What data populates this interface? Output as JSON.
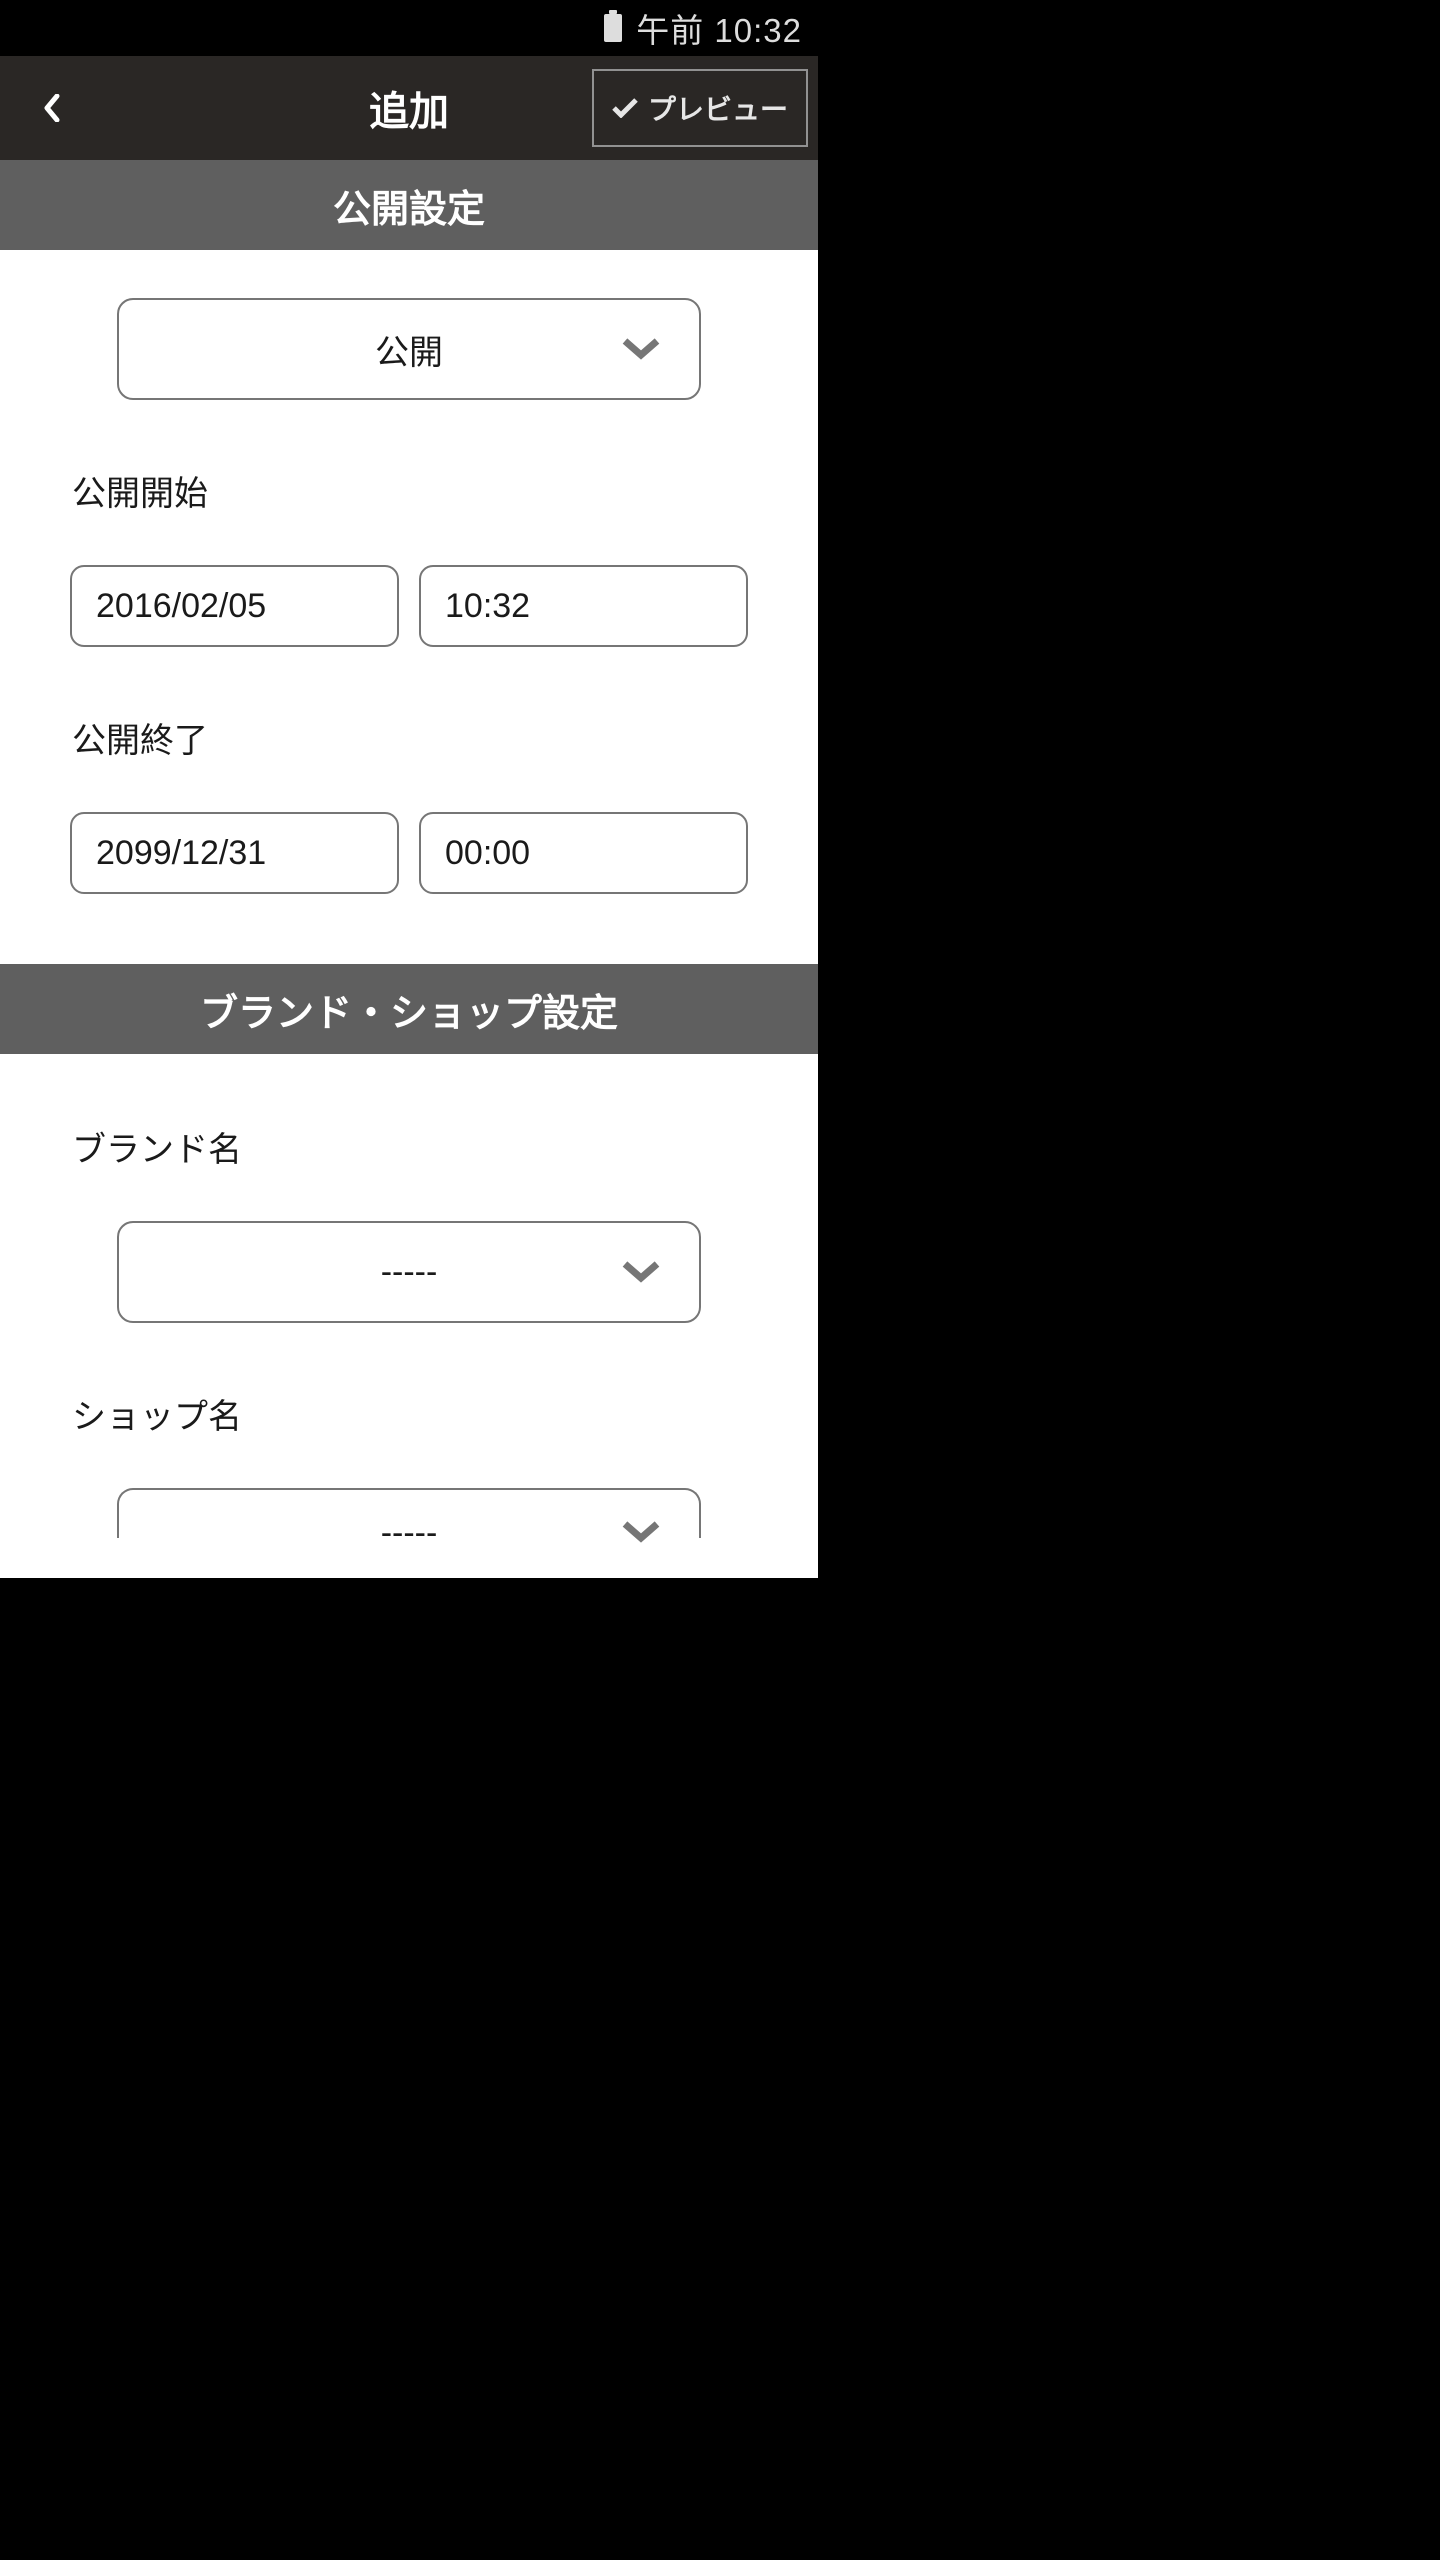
{
  "statusBar": {
    "time": "午前 10:32"
  },
  "header": {
    "title": "追加",
    "previewLabel": "プレビュー"
  },
  "sections": {
    "publishSettings": {
      "title": "公開設定",
      "visibilityDropdown": {
        "selected": "公開"
      },
      "startLabel": "公開開始",
      "startDate": "2016/02/05",
      "startTime": "10:32",
      "endLabel": "公開終了",
      "endDate": "2099/12/31",
      "endTime": "00:00"
    },
    "brandShopSettings": {
      "title": "ブランド・ショップ設定",
      "brandLabel": "ブランド名",
      "brandSelected": "-----",
      "shopLabel": "ショップ名",
      "shopSelected": "-----"
    }
  }
}
